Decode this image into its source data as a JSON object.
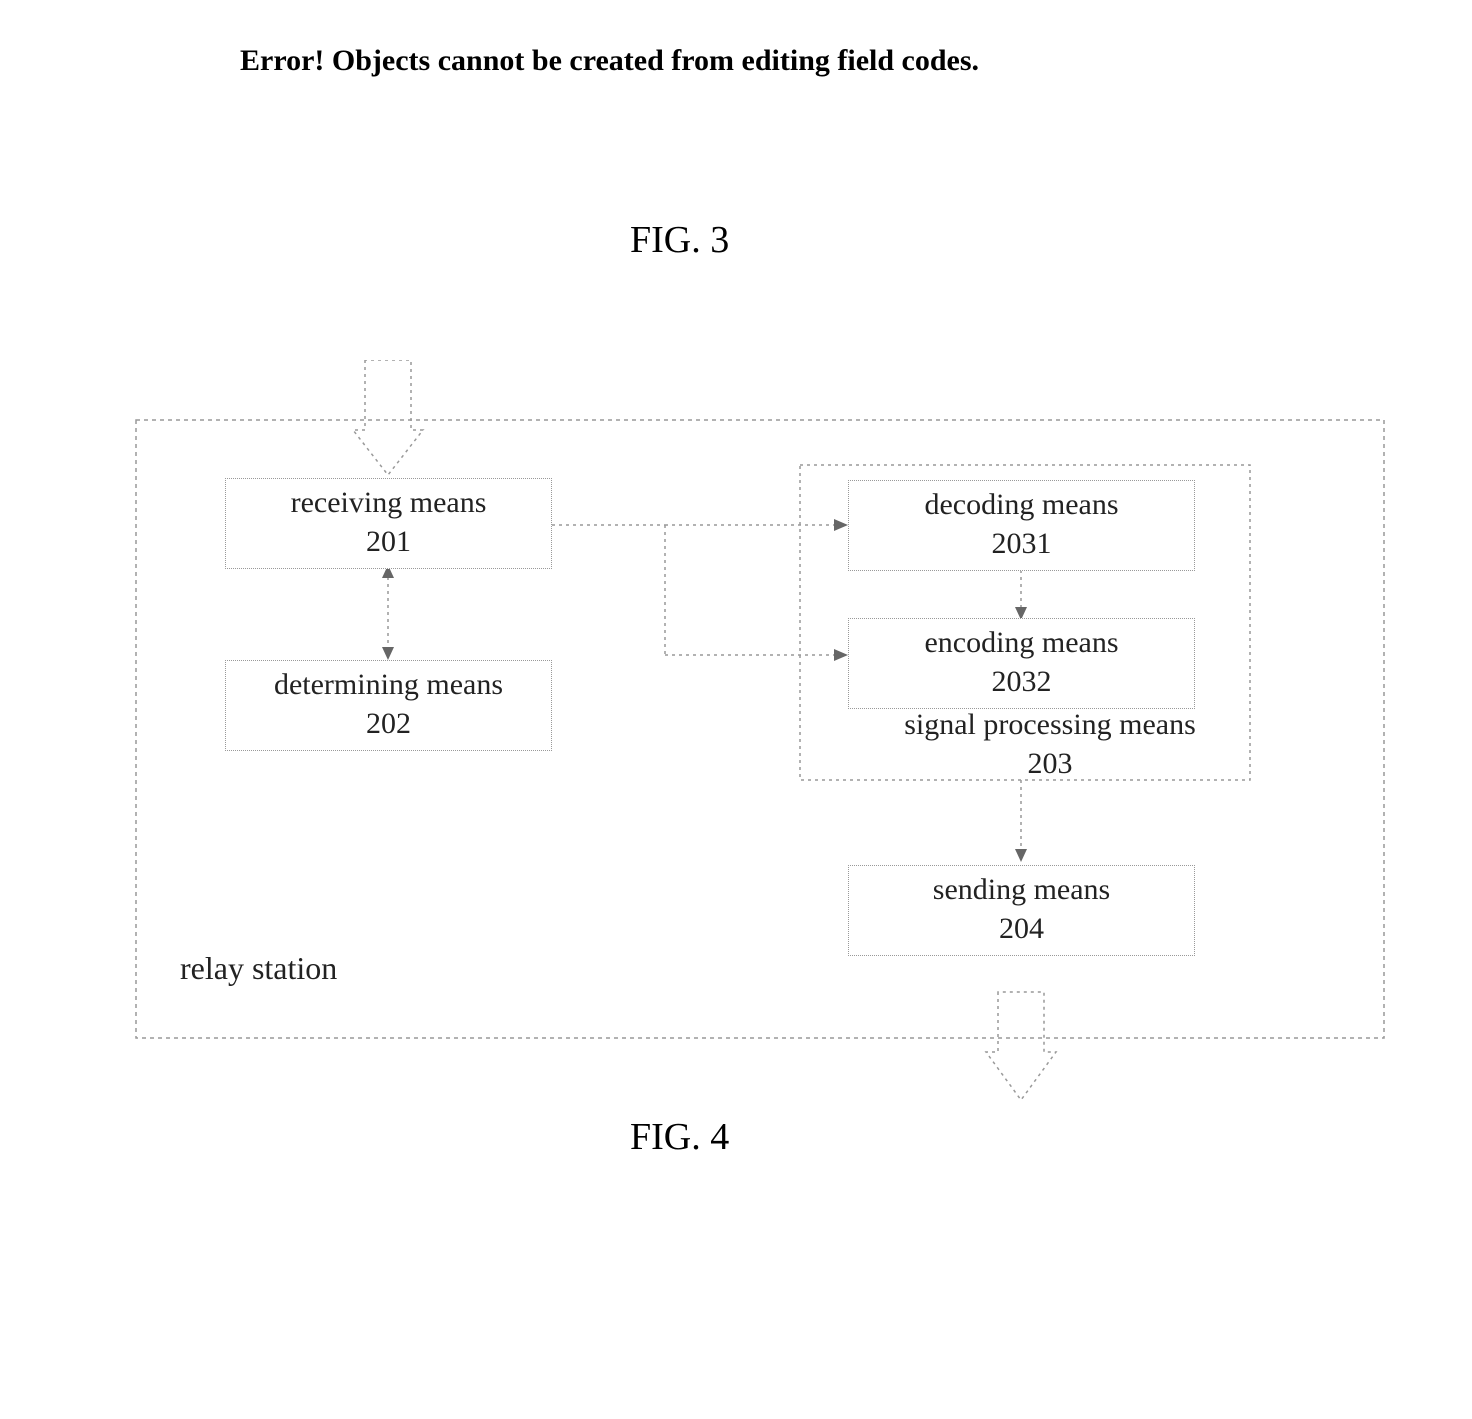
{
  "error_text": "Error! Objects cannot be created from editing field codes.",
  "fig3_label": "FIG. 3",
  "fig4_label": "FIG. 4",
  "relay_label": "relay station",
  "signal_processing_label": "signal processing\nmeans 203",
  "boxes": {
    "receiving": "receiving means\n201",
    "determining": "determining means\n202",
    "decoding": "decoding means\n2031",
    "encoding": "encoding means\n2032",
    "sending": "sending means\n204"
  }
}
